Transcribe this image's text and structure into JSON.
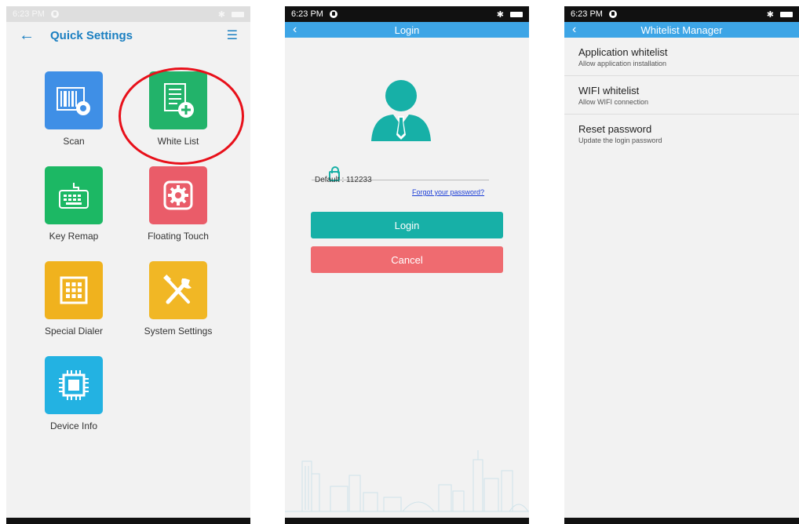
{
  "quick_settings": {
    "status_time": "6:23 PM",
    "title": "Quick Settings",
    "tiles": [
      {
        "label": "Scan",
        "color": "#3f8fe6"
      },
      {
        "label": "White List",
        "color": "#22b36a"
      },
      {
        "label": "Key Remap",
        "color": "#1cb864"
      },
      {
        "label": "Floating Touch",
        "color": "#ea5c69"
      },
      {
        "label": "Special Dialer",
        "color": "#f0b21e"
      },
      {
        "label": "System Settings",
        "color": "#f1b725"
      },
      {
        "label": "Device Info",
        "color": "#23b2e2"
      }
    ],
    "highlight_color": "#e8101a"
  },
  "login": {
    "status_time": "6:23 PM",
    "title": "Login",
    "default_hint": "Default : 112233",
    "forgot_link": "Forgot your password?",
    "login_button": "Login",
    "cancel_button": "Cancel",
    "accent": "#17b0a7"
  },
  "whitelist": {
    "status_time": "6:23 PM",
    "title": "Whitelist Manager",
    "items": [
      {
        "title": "Application whitelist",
        "subtitle": "Allow application installation"
      },
      {
        "title": "WIFI whitelist",
        "subtitle": "Allow WIFI connection"
      },
      {
        "title": "Reset password",
        "subtitle": "Update the login password"
      }
    ]
  }
}
